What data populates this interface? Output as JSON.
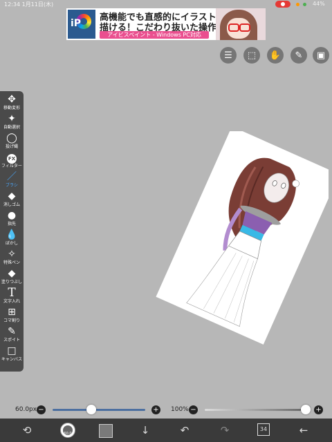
{
  "status_bar": {
    "time": "12:34 1月11日(木)",
    "battery": "44%"
  },
  "ad": {
    "logo_text": "iP",
    "line1": "高機能でも直感的にイラストが",
    "line2": "描ける！こだわり抜いた操作性！",
    "line3": "アイビスペイント - Windows PC対応"
  },
  "top_right_tools": [
    {
      "name": "toggle-panel-icon",
      "glyph": "☰"
    },
    {
      "name": "selection-icon",
      "glyph": "⬚"
    },
    {
      "name": "hand-icon",
      "glyph": "✋"
    },
    {
      "name": "ruler-icon",
      "glyph": "📏"
    },
    {
      "name": "material-icon",
      "glyph": "▣"
    }
  ],
  "left_tools": [
    {
      "name": "move-transform",
      "glyph": "✥",
      "label": "移動変形"
    },
    {
      "name": "auto-select",
      "glyph": "✦",
      "label": "自動選択"
    },
    {
      "name": "lasso",
      "glyph": "◯",
      "label": "投げ縄"
    },
    {
      "name": "filter",
      "glyph": "FX",
      "label": "フィルター"
    },
    {
      "name": "brush",
      "glyph": "／",
      "label": "ブラシ"
    },
    {
      "name": "eraser",
      "glyph": "◆",
      "label": "消しゴム"
    },
    {
      "name": "smudge",
      "glyph": "●",
      "label": "指先"
    },
    {
      "name": "blur",
      "glyph": "💧",
      "label": "ぼかし"
    },
    {
      "name": "special-pen",
      "glyph": "✧",
      "label": "特殊ペン"
    },
    {
      "name": "fill",
      "glyph": "◆",
      "label": "塗りつぶし"
    },
    {
      "name": "text",
      "glyph": "T",
      "label": "文字入れ"
    },
    {
      "name": "frame-divider",
      "glyph": "⊞",
      "label": "コマ割り"
    },
    {
      "name": "eyedropper",
      "glyph": "✎",
      "label": "スポイト"
    },
    {
      "name": "canvas",
      "glyph": "□",
      "label": "キャンバス"
    }
  ],
  "active_tool": "brush",
  "sliders": {
    "size_label": "60.0px",
    "size_fraction": 0.42,
    "opacity_label": "100%",
    "opacity_fraction": 1.0,
    "minus": "−",
    "plus": "+"
  },
  "bottom_bar": {
    "transform_glyph": "⟲",
    "brush_size_label": "60.0",
    "undo_glyph": "↶",
    "redo_glyph": "↷",
    "down_glyph": "↓",
    "layer_count": "34",
    "back_glyph": "←"
  },
  "colors": {
    "accent": "#4aa8ff",
    "ad_pink": "#ea4f8f",
    "toolbar": "#4a4a4a"
  }
}
